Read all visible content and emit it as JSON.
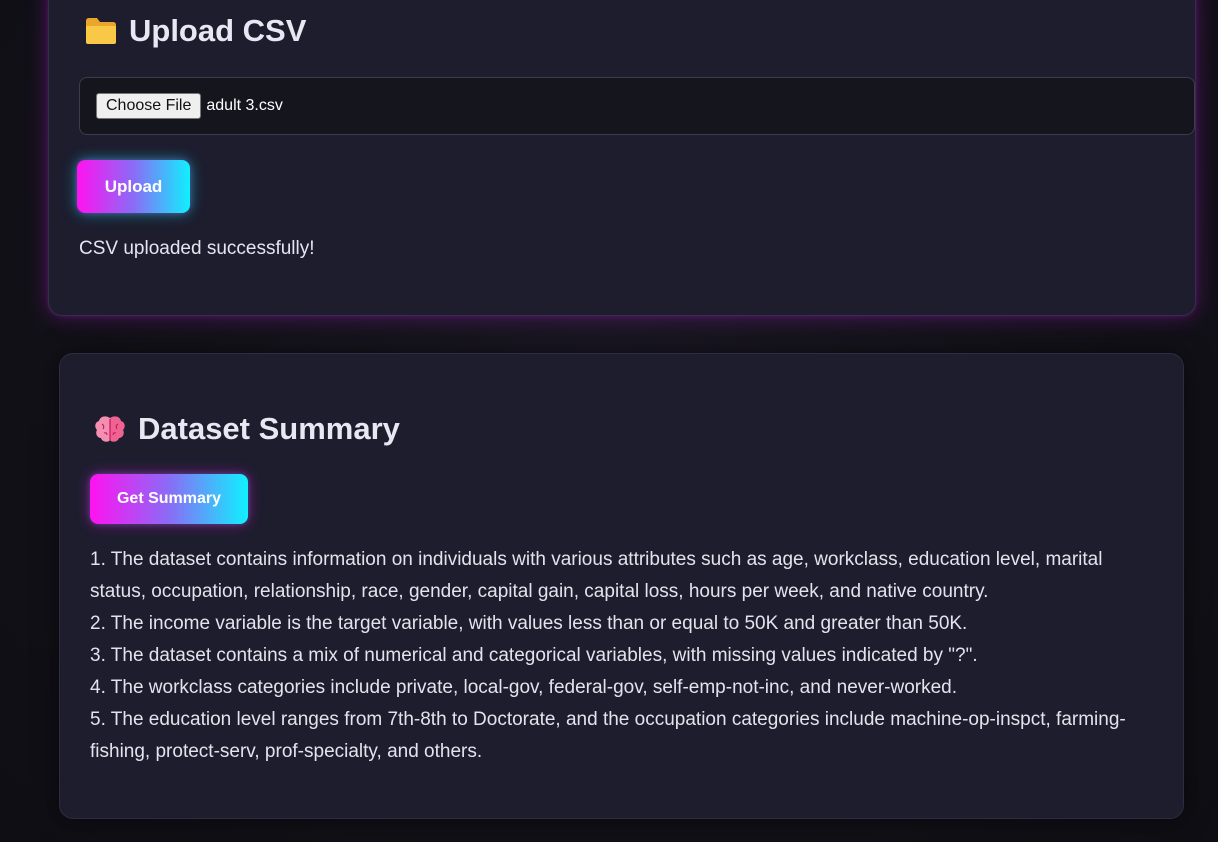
{
  "upload": {
    "title": "Upload CSV",
    "icon": "folder-icon",
    "choose_file_label": "Choose File",
    "file_name": "adult 3.csv",
    "upload_button": "Upload",
    "status": "CSV uploaded successfully!"
  },
  "summary": {
    "title": "Dataset Summary",
    "icon": "brain-icon",
    "button": "Get Summary",
    "lines": [
      "1. The dataset contains information on individuals with various attributes such as age, workclass, education level, marital status, occupation, relationship, race, gender, capital gain, capital loss, hours per week, and native country.",
      "2. The income variable is the target variable, with values less than or equal to 50K and greater than 50K.",
      "3. The dataset contains a mix of numerical and categorical variables, with missing values indicated by \"?\".",
      "4. The workclass categories include private, local-gov, federal-gov, self-emp-not-inc, and never-worked.",
      "5. The education level ranges from 7th-8th to Doctorate, and the occupation categories include machine-op-inspct, farming-fishing, protect-serv, prof-specialty, and others."
    ]
  },
  "colors": {
    "background": "#131219",
    "card": "#1d1d2e",
    "gradient_start": "#ff12f0",
    "gradient_end": "#10f0ff",
    "glow": "#be1edc"
  }
}
